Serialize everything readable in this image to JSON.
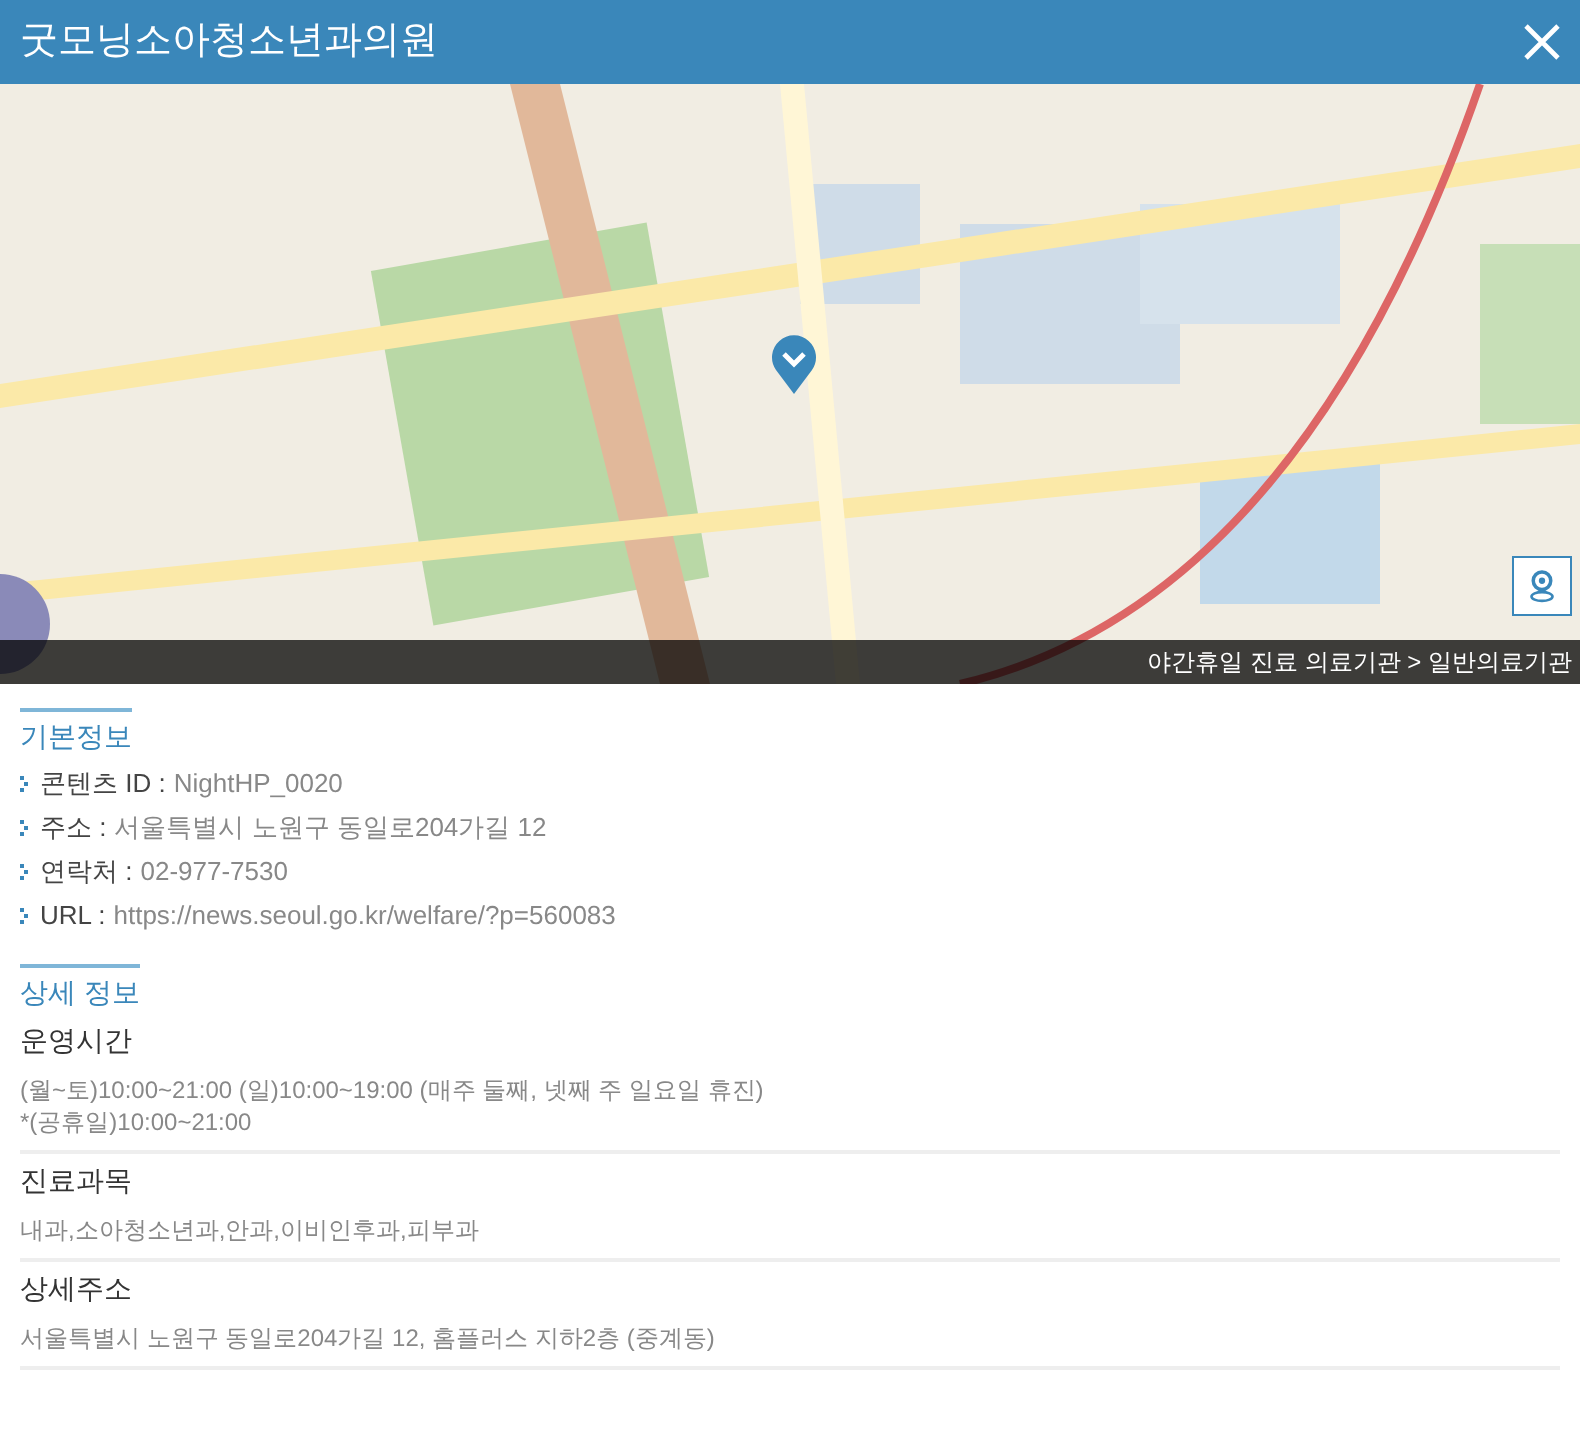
{
  "window": {
    "title": "굿모닝소아청소년과의원"
  },
  "map": {
    "breadcrumb": "야간휴일 진료 의료기관 > 일반의료기관"
  },
  "basic_info": {
    "heading": "기본정보",
    "items": [
      {
        "label": "콘텐츠 ID :",
        "value": "NightHP_0020"
      },
      {
        "label": "주소 :",
        "value": "서울특별시 노원구 동일로204가길 12"
      },
      {
        "label": "연락처 :",
        "value": "02-977-7530"
      },
      {
        "label": "URL :",
        "value": "https://news.seoul.go.kr/welfare/?p=560083"
      }
    ]
  },
  "detail_info": {
    "heading": "상세 정보",
    "sections": [
      {
        "title": "운영시간",
        "lines": [
          "(월~토)10:00~21:00 (일)10:00~19:00 (매주 둘째, 넷째 주 일요일 휴진)",
          "*(공휴일)10:00~21:00"
        ]
      },
      {
        "title": "진료과목",
        "lines": [
          "내과,소아청소년과,안과,이비인후과,피부과"
        ]
      },
      {
        "title": "상세주소",
        "lines": [
          "서울특별시 노원구 동일로204가길 12, 홈플러스 지하2층 (중계동)"
        ]
      }
    ]
  }
}
